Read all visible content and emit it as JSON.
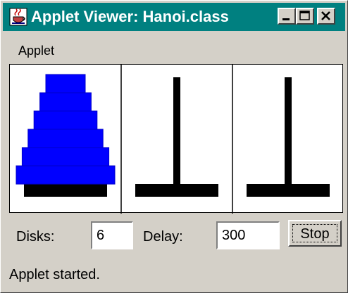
{
  "window": {
    "title": "Applet Viewer: Hanoi.class",
    "title_bar_color": "#008080",
    "controls": [
      "minimize-icon",
      "maximize-icon",
      "close-icon"
    ]
  },
  "menubar": {
    "items": [
      {
        "label": "Applet"
      }
    ]
  },
  "hanoi": {
    "disk_color": "#0000ff",
    "peg_color": "#000000",
    "pegs": [
      {
        "disk_count": 6
      },
      {
        "disk_count": 0
      },
      {
        "disk_count": 0
      }
    ]
  },
  "controls": {
    "disks_label": "Disks:",
    "disks_value": "6",
    "delay_label": "Delay:",
    "delay_value": "300",
    "stop_label": "Stop"
  },
  "status": {
    "text": "Applet started."
  }
}
